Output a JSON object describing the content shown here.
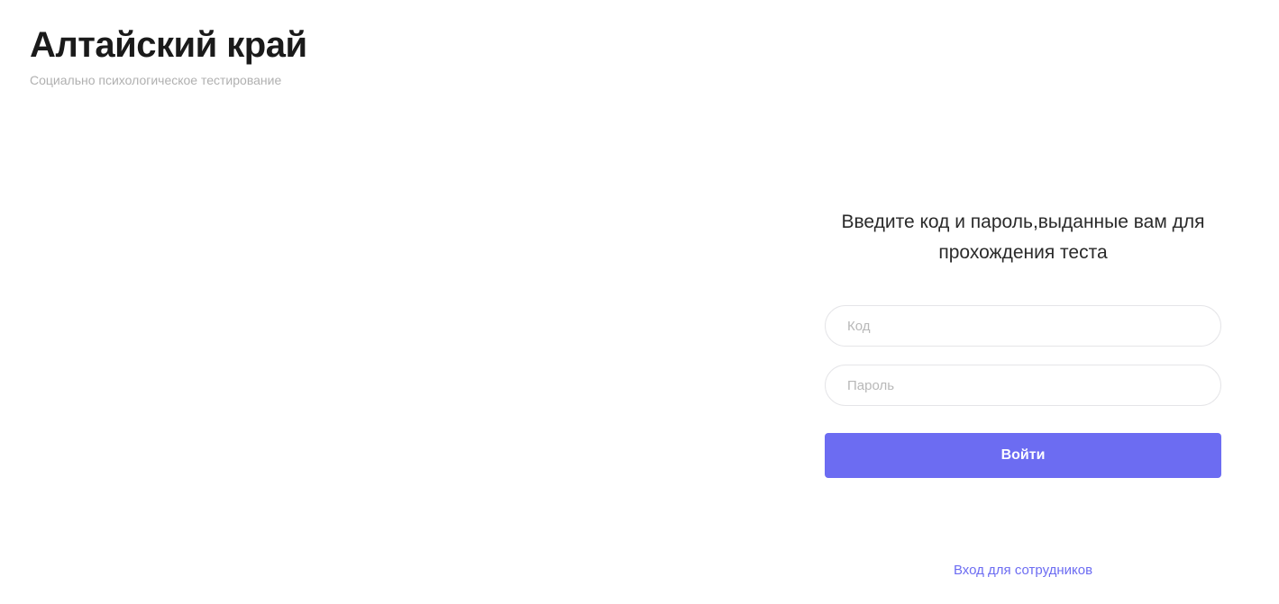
{
  "header": {
    "title": "Алтайский край",
    "subtitle": "Социально психологическое тестирование"
  },
  "form": {
    "instruction": "Введите код и пароль,выданные вам для прохождения теста",
    "code_placeholder": "Код",
    "code_value": "",
    "password_placeholder": "Пароль",
    "password_value": "",
    "submit_label": "Войти"
  },
  "footer": {
    "staff_login_label": "Вход для сотрудников"
  }
}
